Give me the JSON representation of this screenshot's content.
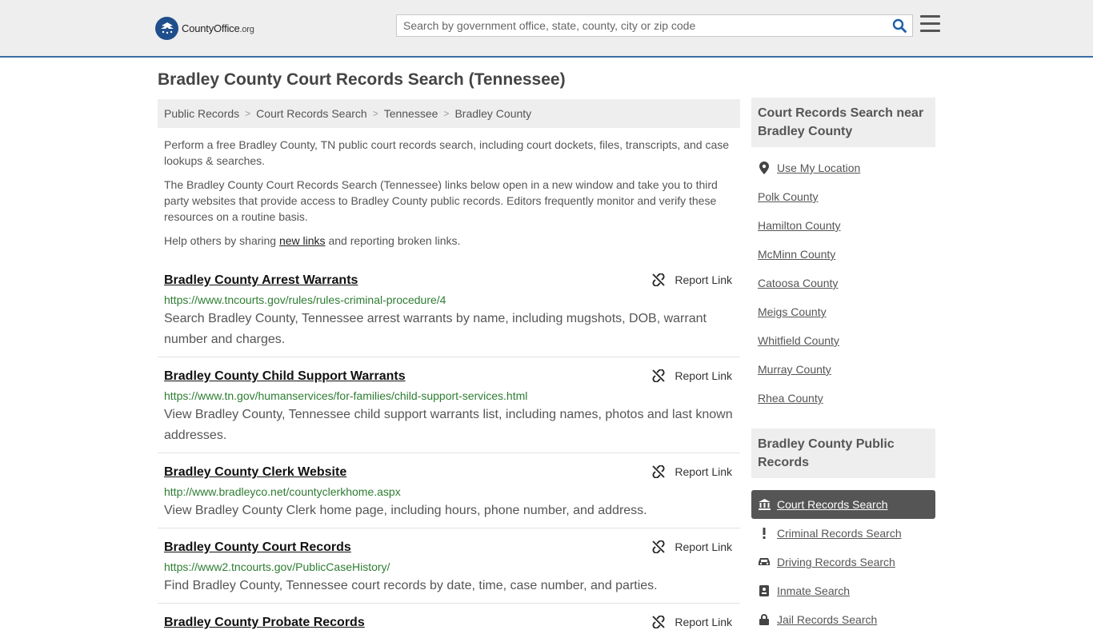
{
  "header": {
    "logo_text": "CountyOffice",
    "logo_suffix": ".org",
    "search_placeholder": "Search by government office, state, county, city or zip code"
  },
  "page_title": "Bradley County Court Records Search (Tennessee)",
  "breadcrumb": [
    "Public Records",
    "Court Records Search",
    "Tennessee",
    "Bradley County"
  ],
  "intro": {
    "p1": "Perform a free Bradley County, TN public court records search, including court dockets, files, transcripts, and case lookups & searches.",
    "p2": "The Bradley County Court Records Search (Tennessee) links below open in a new window and take you to third party websites that provide access to Bradley County public records. Editors frequently monitor and verify these resources on a routine basis.",
    "p3_before": "Help others by sharing ",
    "p3_link": "new links",
    "p3_after": " and reporting broken links."
  },
  "report_label": "Report Link",
  "records": [
    {
      "title": "Bradley County Arrest Warrants",
      "url": "https://www.tncourts.gov/rules/rules-criminal-procedure/4",
      "desc": "Search Bradley County, Tennessee arrest warrants by name, including mugshots, DOB, warrant number and charges."
    },
    {
      "title": "Bradley County Child Support Warrants",
      "url": "https://www.tn.gov/humanservices/for-families/child-support-services.html",
      "desc": "View Bradley County, Tennessee child support warrants list, including names, photos and last known addresses."
    },
    {
      "title": "Bradley County Clerk Website",
      "url": "http://www.bradleyco.net/countyclerkhome.aspx",
      "desc": "View Bradley County Clerk home page, including hours, phone number, and address."
    },
    {
      "title": "Bradley County Court Records",
      "url": "https://www2.tncourts.gov/PublicCaseHistory/",
      "desc": "Find Bradley County, Tennessee court records by date, time, case number, and parties."
    },
    {
      "title": "Bradley County Probate Records",
      "url": "",
      "desc": ""
    }
  ],
  "sidebar": {
    "near_heading": "Court Records Search near Bradley County",
    "use_location": "Use My Location",
    "nearby": [
      "Polk County",
      "Hamilton County",
      "McMinn County",
      "Catoosa County",
      "Meigs County",
      "Whitfield County",
      "Murray County",
      "Rhea County"
    ],
    "public_heading": "Bradley County Public Records",
    "public_links": [
      {
        "label": "Court Records Search",
        "icon": "courthouse-icon",
        "active": true
      },
      {
        "label": "Criminal Records Search",
        "icon": "exclamation-icon",
        "active": false
      },
      {
        "label": "Driving Records Search",
        "icon": "car-icon",
        "active": false
      },
      {
        "label": "Inmate Search",
        "icon": "id-badge-icon",
        "active": false
      },
      {
        "label": "Jail Records Search",
        "icon": "lock-icon",
        "active": false
      }
    ]
  }
}
